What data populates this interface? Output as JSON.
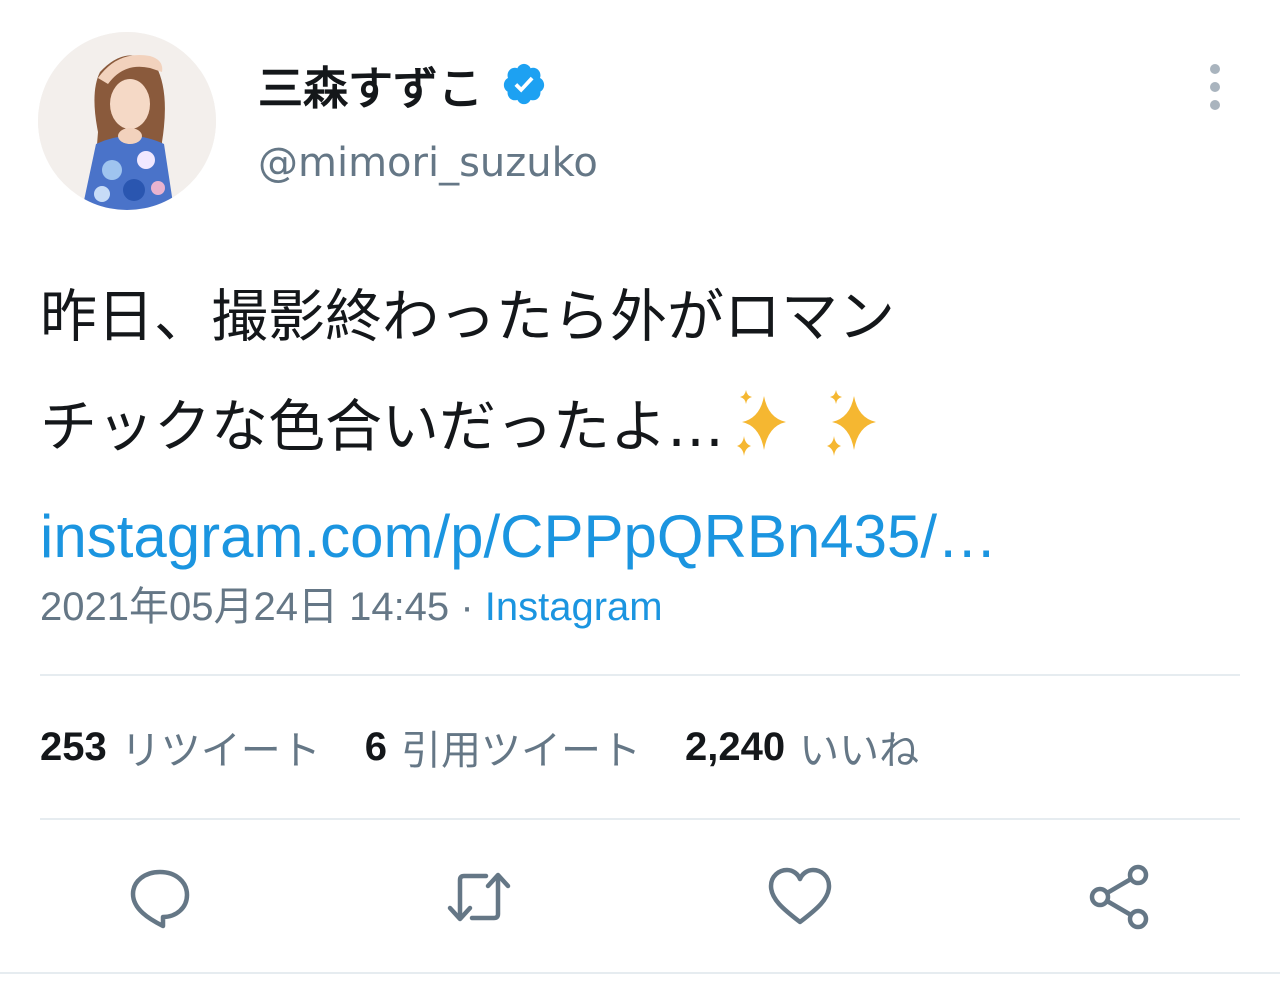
{
  "user": {
    "display_name": "三森すずこ",
    "handle": "@mimori_suzuko",
    "verified_icon": "verified-badge-icon",
    "avatar": "avatar-photo"
  },
  "tweet": {
    "lines": [
      "昨日、撮影終わったら外がロマン",
      "チックな色合いだったよ…"
    ],
    "emoji": "sparkles",
    "link": "instagram.com/p/CPPpQRBn435/…"
  },
  "meta": {
    "timestamp": "2021年05月24日 14:45",
    "separator": "·",
    "source": "Instagram"
  },
  "stats": {
    "retweets": "253",
    "retweets_label": "リツイート",
    "quotes": "6",
    "quotes_label": "引用ツイート",
    "likes": "2,240",
    "likes_label": "いいね"
  },
  "actions": {
    "reply_icon": "reply-icon",
    "retweet_icon": "retweet-icon",
    "like_icon": "heart-icon",
    "share_icon": "share-icon"
  },
  "colors": {
    "link": "#1b95e0",
    "secondary_text": "#657786",
    "divider": "#e6ecf0",
    "icon": "#657786",
    "verified": "#1da1f2",
    "sparkle": "#f5b731"
  }
}
